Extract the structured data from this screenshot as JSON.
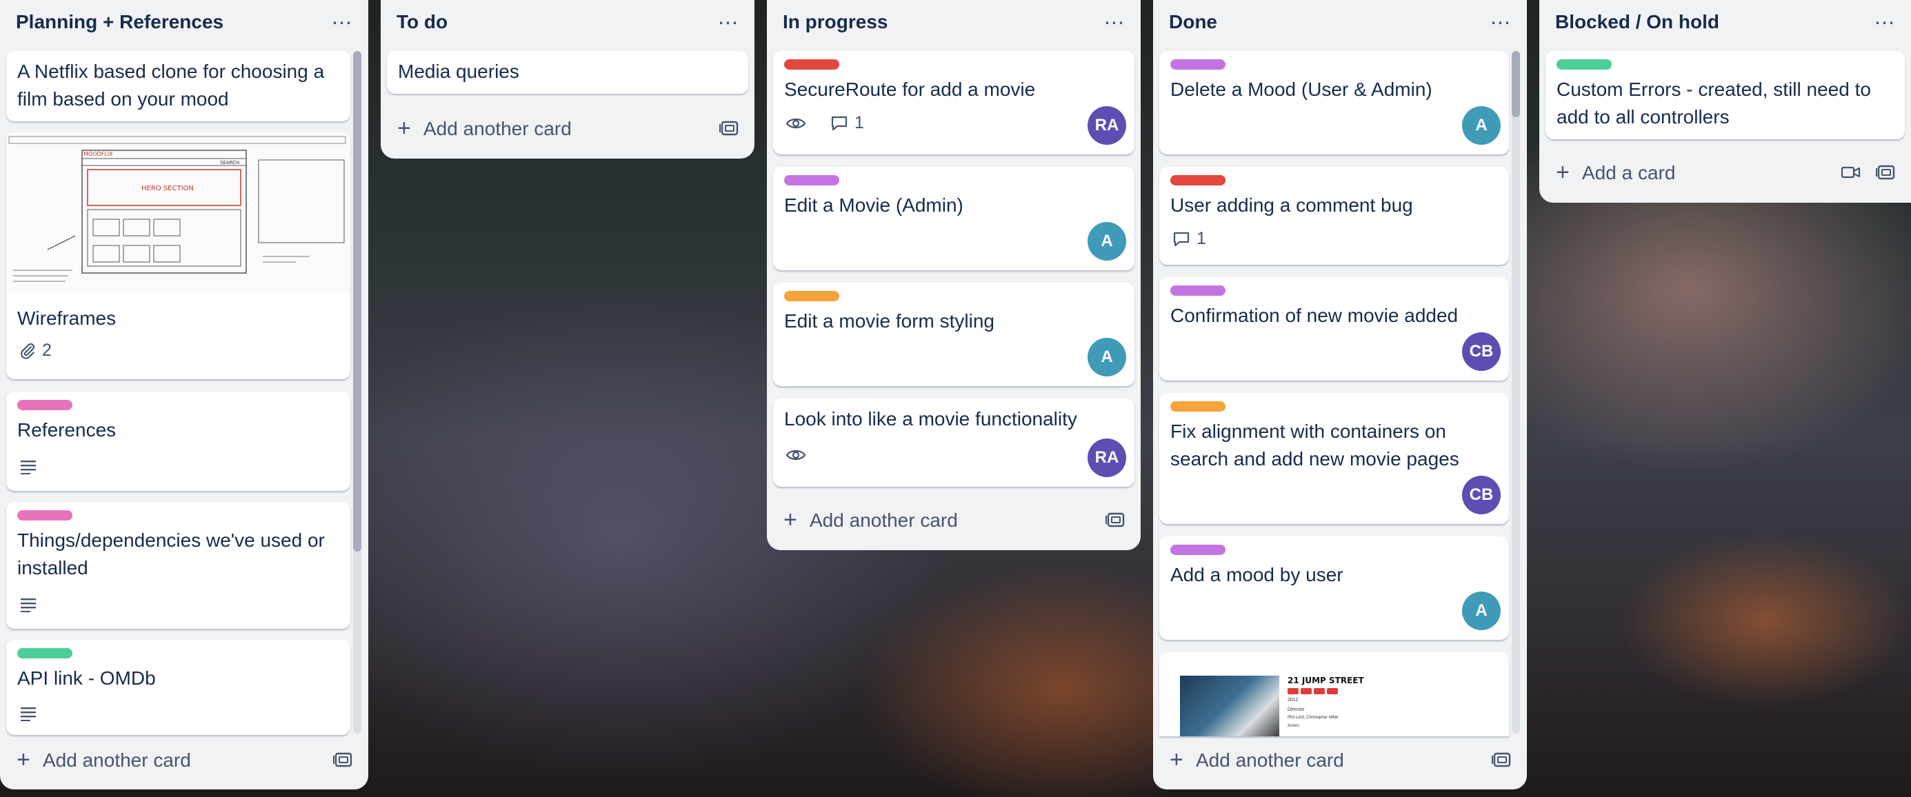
{
  "lists": {
    "planning": {
      "title": "Planning + References",
      "cards": {
        "netflix": {
          "title": "A Netflix based clone for choosing a film based on your mood"
        },
        "wireframes": {
          "title": "Wireframes",
          "attachments": "2",
          "sketch_title": "HERO SECTION",
          "sketch_header": "MOODFLIX",
          "sketch_search": "SEARCH"
        },
        "references": {
          "title": "References",
          "label_color": "#e774bb"
        },
        "deps": {
          "title": "Things/dependencies we've used or installed",
          "label_color": "#e774bb"
        },
        "api": {
          "title": "API link - OMDb",
          "label_color": "#4bce97"
        }
      },
      "add_label": "Add another card"
    },
    "todo": {
      "title": "To do",
      "cards": {
        "media": {
          "title": "Media queries"
        }
      },
      "add_label": "Add another card"
    },
    "inprogress": {
      "title": "In progress",
      "cards": {
        "secure": {
          "title": "SecureRoute for add a movie",
          "label_color": "#e2483d",
          "comments": "1",
          "avatar": "RA"
        },
        "edit_movie": {
          "title": "Edit a Movie (Admin)",
          "label_color": "#c374e3",
          "avatar": "A"
        },
        "edit_form": {
          "title": "Edit a movie form styling",
          "label_color": "#f5a33a",
          "avatar": "A"
        },
        "like": {
          "title": "Look into like a movie functionality",
          "avatar": "RA"
        }
      },
      "add_label": "Add another card"
    },
    "done": {
      "title": "Done",
      "cards": {
        "delete_mood": {
          "title": "Delete a Mood (User & Admin)",
          "label_color": "#c374e3",
          "avatar": "A"
        },
        "comment_bug": {
          "title": "User adding a comment bug",
          "label_color": "#e2483d",
          "comments": "1"
        },
        "confirm": {
          "title": "Confirmation of new movie added",
          "label_color": "#c374e3",
          "avatar": "CB"
        },
        "fix_align": {
          "title": "Fix alignment with containers on search and add new movie pages",
          "label_color": "#f5a33a",
          "avatar": "CB"
        },
        "add_mood": {
          "title": "Add a mood by user",
          "label_color": "#c374e3",
          "avatar": "A"
        },
        "jump": {
          "movie_title": "21 JUMP STREET",
          "year": "2012",
          "director_label": "Director",
          "director": "Phil Lord, Christopher Miller",
          "actors_label": "Actors"
        }
      },
      "add_label": "Add another card"
    },
    "blocked": {
      "title": "Blocked / On hold",
      "cards": {
        "errors": {
          "title": "Custom Errors - created, still need to add to all controllers",
          "label_color": "#4bce97"
        }
      },
      "add_label": "Add a card"
    }
  },
  "colors": {
    "avatar_ra": "#5e4db2",
    "avatar_a": "#3f9bb8",
    "avatar_cb": "#5e4db2"
  }
}
